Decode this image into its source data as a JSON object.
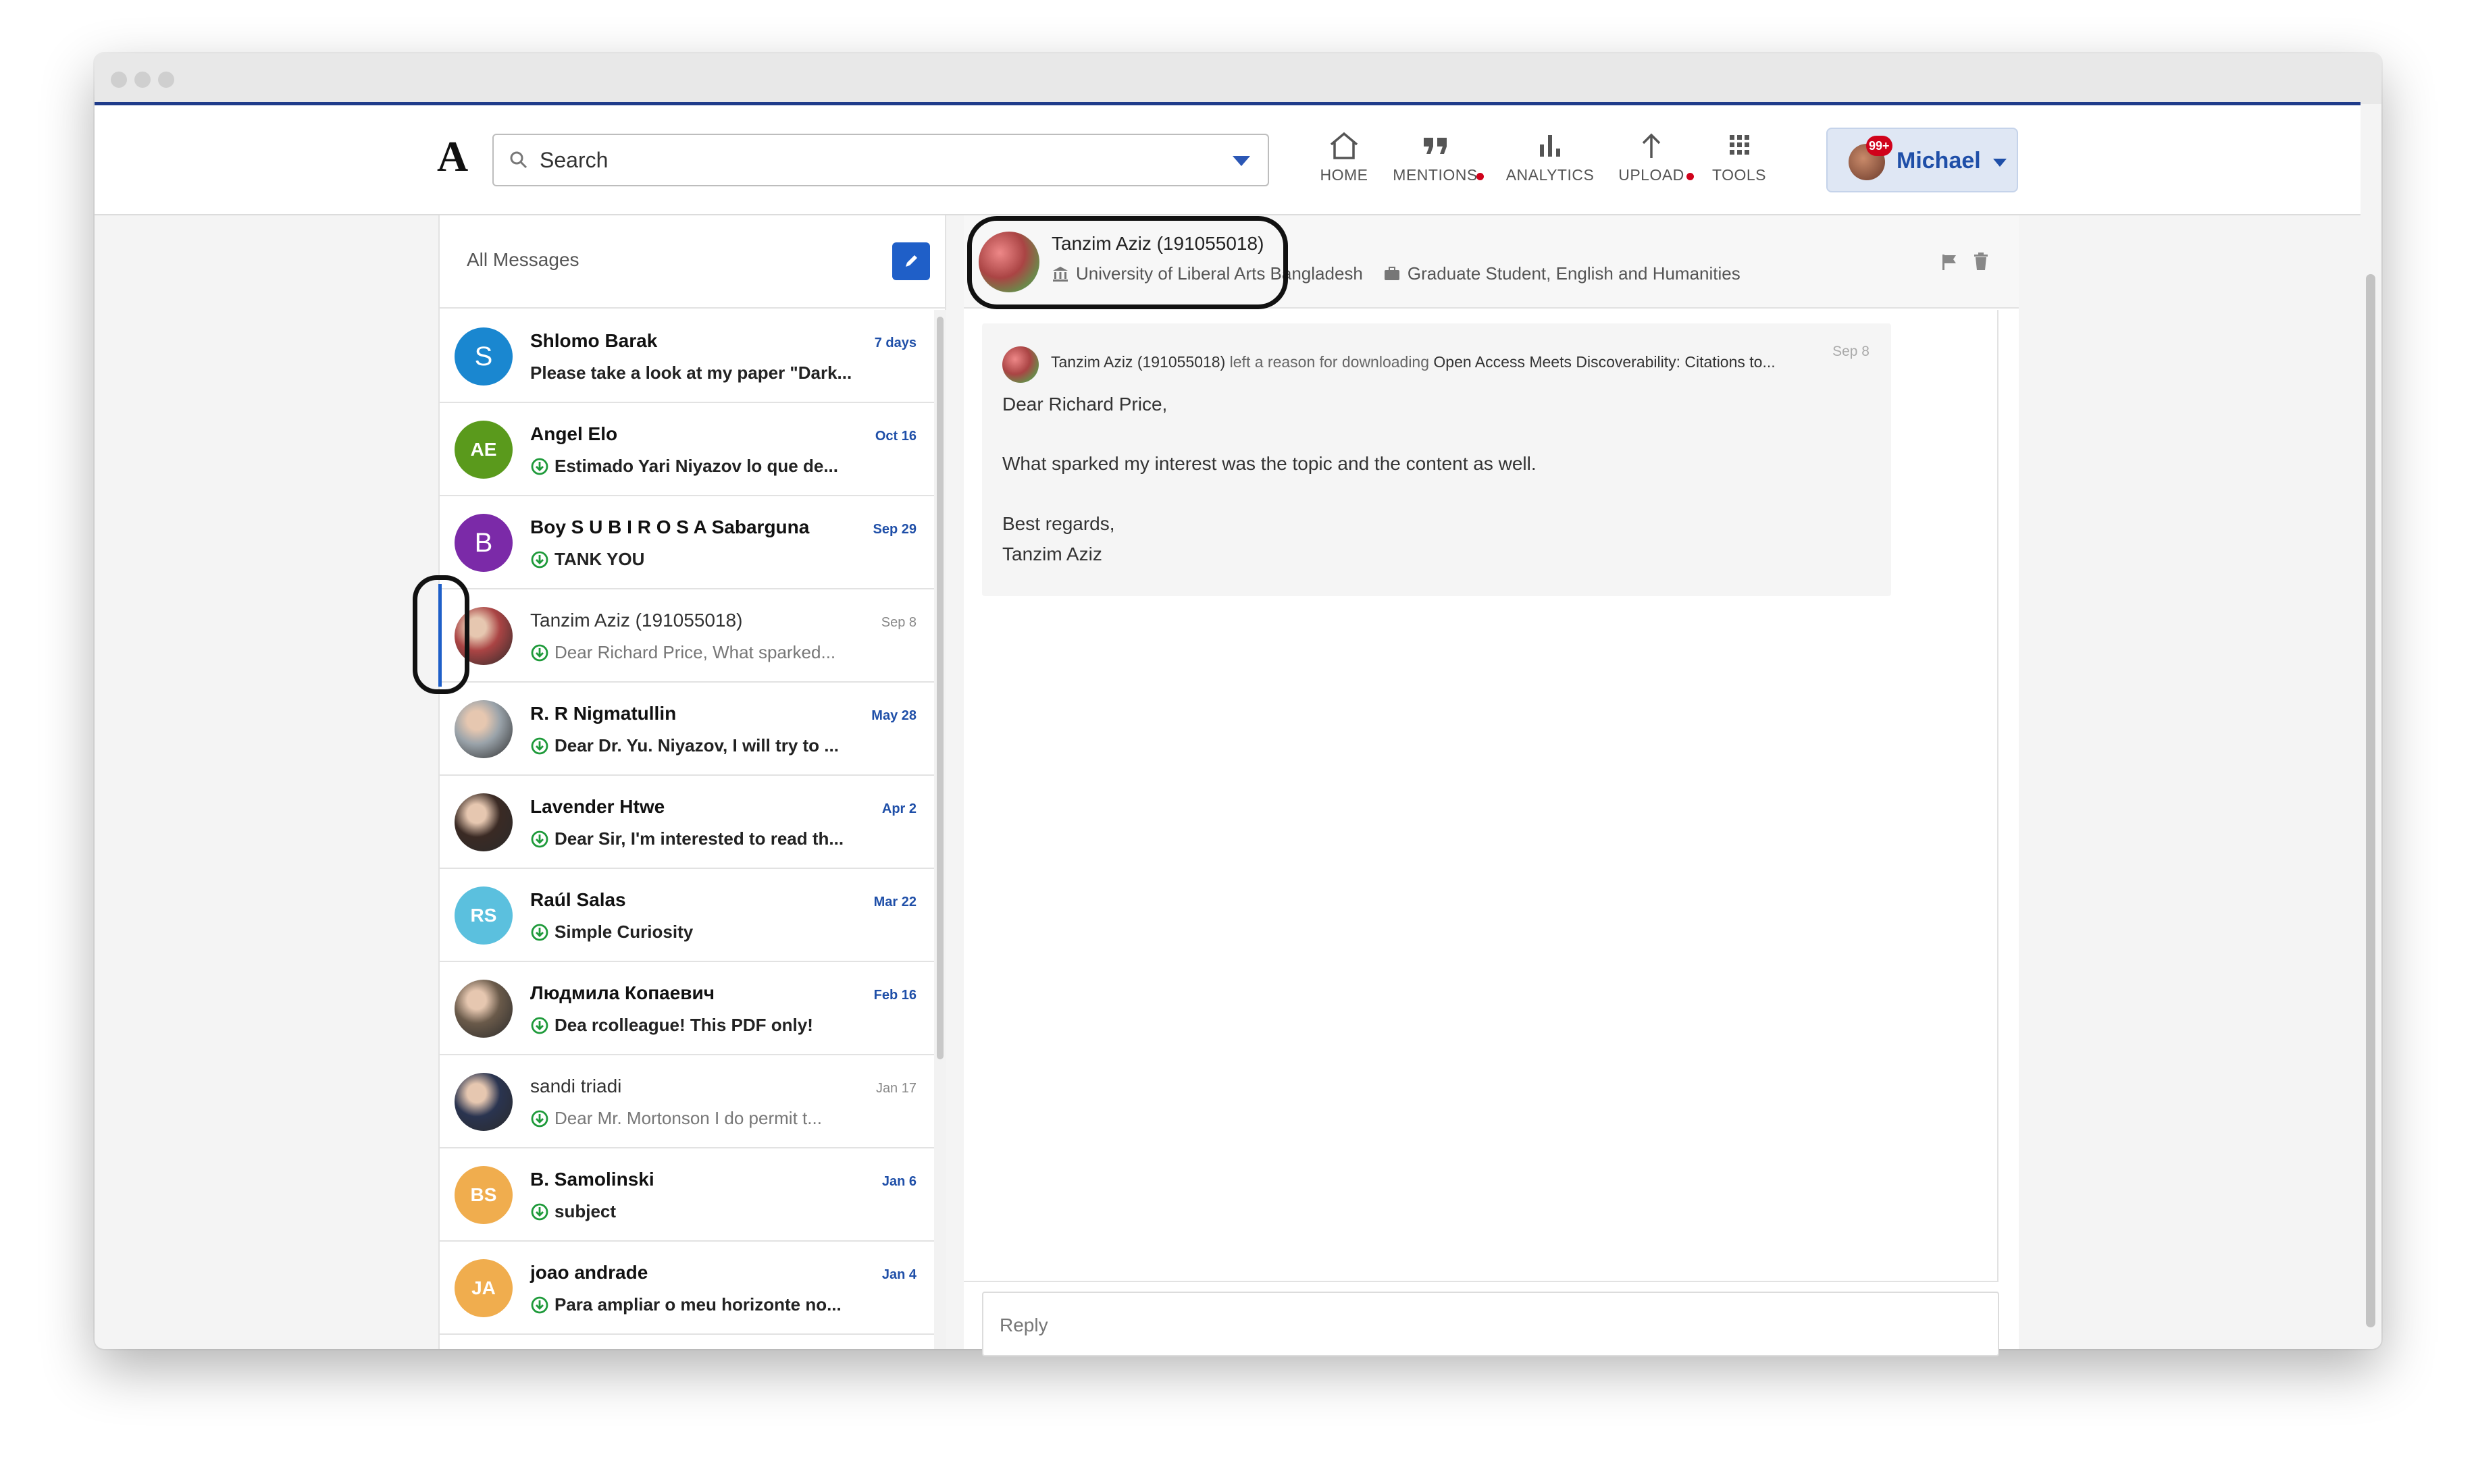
{
  "app": {
    "logo": "A"
  },
  "search": {
    "placeholder": "Search"
  },
  "nav": {
    "home": "HOME",
    "mentions": "MENTIONS",
    "analytics": "ANALYTICS",
    "upload": "UPLOAD",
    "tools": "TOOLS"
  },
  "user": {
    "name": "Michael",
    "badge": "99+"
  },
  "inbox": {
    "title": "All Messages",
    "conversations": [
      {
        "name": "Shlomo Barak",
        "date": "7 days",
        "snippet": "Please take a look at my paper \"Dark...",
        "avatar": "S",
        "avatar_color": "#1a87d0",
        "unread": true,
        "download_icon": false
      },
      {
        "name": "Angel Elo",
        "date": "Oct 16",
        "snippet": "Estimado Yari Niyazov lo que de...",
        "avatar": "AE",
        "avatar_color": "#5a9a1c",
        "unread": true,
        "download_icon": true
      },
      {
        "name": "Boy S U B I R O S A Sabarguna",
        "date": "Sep 29",
        "snippet": "TANK YOU",
        "avatar": "B",
        "avatar_color": "#7b2aa8",
        "unread": true,
        "download_icon": true
      },
      {
        "name": "Tanzim Aziz (191055018)",
        "date": "Sep 8",
        "snippet": "Dear Richard Price, What sparked...",
        "avatar": "photo",
        "avatar_color": "#a44",
        "unread": false,
        "download_icon": true
      },
      {
        "name": "R. R Nigmatullin",
        "date": "May 28",
        "snippet": "Dear Dr. Yu. Niyazov, I will try to ...",
        "avatar": "photo",
        "avatar_color": "#9aa3aa",
        "unread": true,
        "download_icon": true
      },
      {
        "name": "Lavender Htwe",
        "date": "Apr 2",
        "snippet": "Dear Sir, I'm interested to read th...",
        "avatar": "photo",
        "avatar_color": "#3a2a24",
        "unread": true,
        "download_icon": true
      },
      {
        "name": "Raúl Salas",
        "date": "Mar 22",
        "snippet": "Simple Curiosity",
        "avatar": "RS",
        "avatar_color": "#5bc0de",
        "unread": true,
        "download_icon": true
      },
      {
        "name": "Людмила Копаевич",
        "date": "Feb 16",
        "snippet": "Dea rcolleague! This PDF only!",
        "avatar": "photo",
        "avatar_color": "#6a5a4a",
        "unread": true,
        "download_icon": true
      },
      {
        "name": "sandi triadi",
        "date": "Jan 17",
        "snippet": "Dear Mr. Mortonson I do permit t...",
        "avatar": "photo",
        "avatar_color": "#2a3450",
        "unread": false,
        "download_icon": true
      },
      {
        "name": "B. Samolinski",
        "date": "Jan 6",
        "snippet": "subject",
        "avatar": "BS",
        "avatar_color": "#f0ad4e",
        "unread": true,
        "download_icon": true
      },
      {
        "name": "joao andrade",
        "date": "Jan 4",
        "snippet": "Para ampliar o meu horizonte no...",
        "avatar": "JA",
        "avatar_color": "#f0ad4e",
        "unread": true,
        "download_icon": true
      }
    ]
  },
  "conversation": {
    "name": "Tanzim Aziz (191055018)",
    "institution": "University of Liberal Arts Bangladesh",
    "position": "Graduate Student, English and Humanities",
    "message": {
      "sender": "Tanzim Aziz (191055018)",
      "action": "left a reason for downloading",
      "paper": "Open Access Meets Discoverability: Citations to...",
      "date": "Sep 8",
      "lines": [
        "Dear Richard Price,",
        "What sparked my interest was the topic and the content as well.",
        "Best regards,",
        "Tanzim Aziz"
      ]
    }
  },
  "reply": {
    "placeholder": "Reply"
  },
  "colors": {
    "accent": "#1f5fc8",
    "brand_line": "#1f3b8a",
    "notification": "#d0021b",
    "link_blue": "#1f4fa8"
  }
}
